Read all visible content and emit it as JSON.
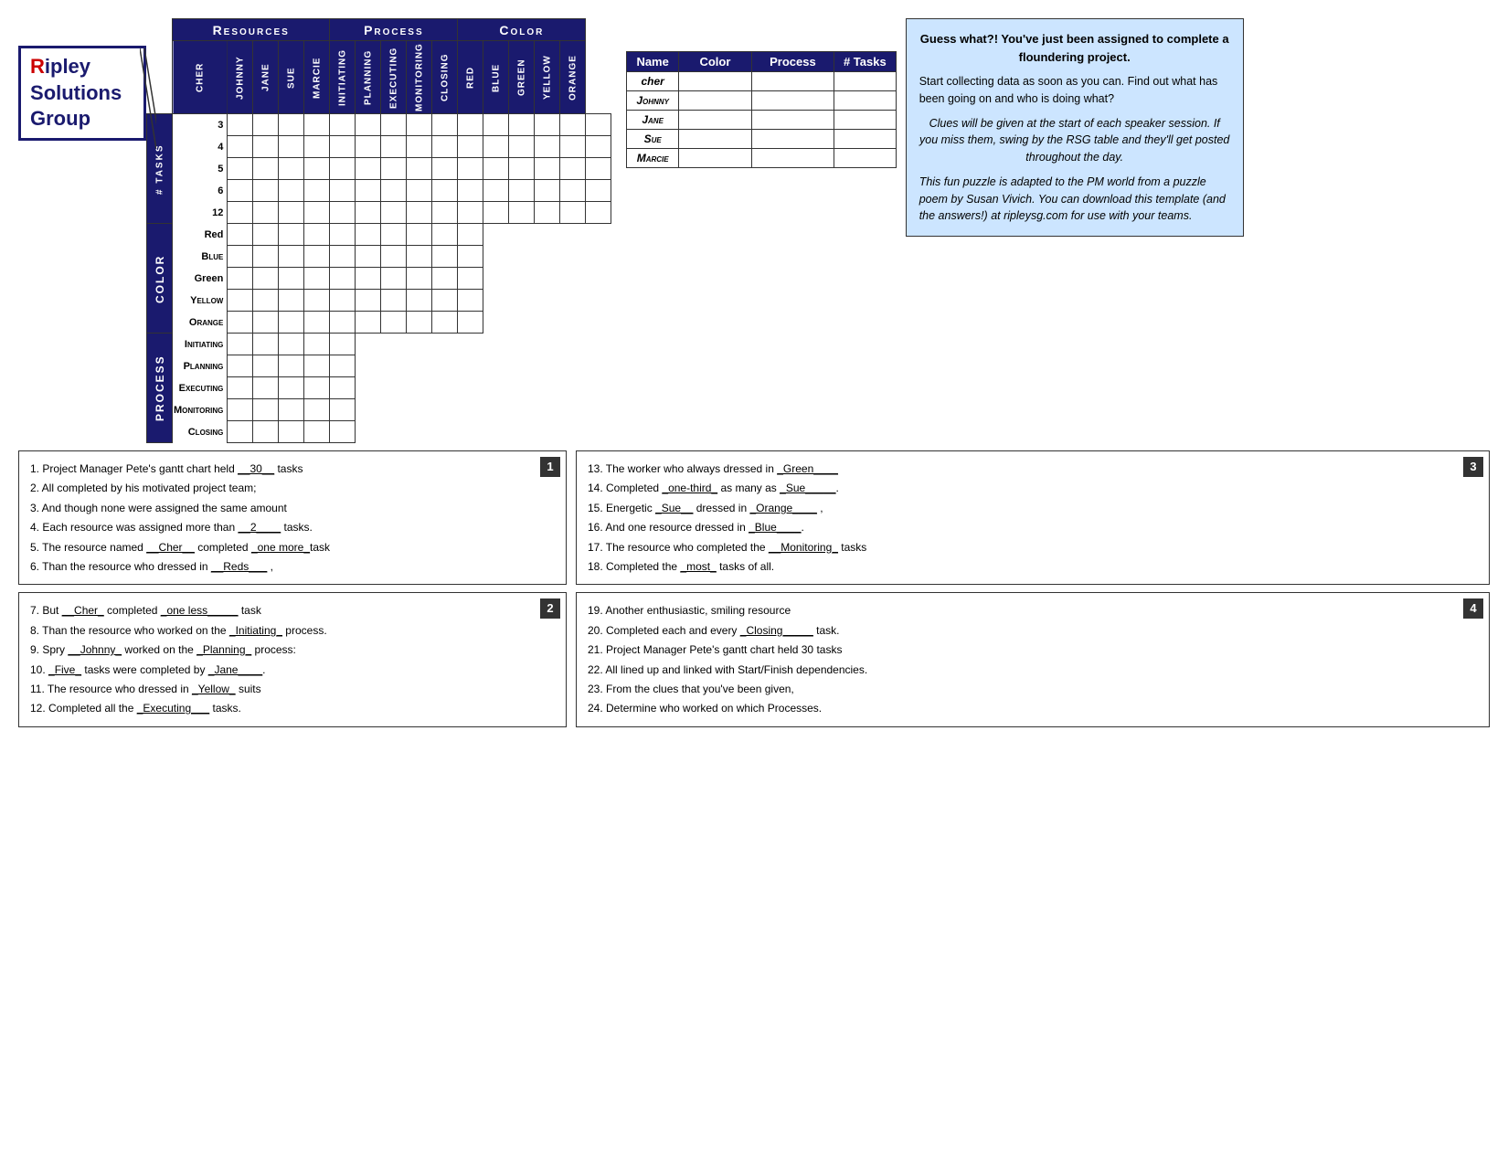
{
  "logo": {
    "r": "R",
    "ipley": "ipley",
    "s": "S",
    "olutions": "olutions",
    "g": "G",
    "roup": "roup"
  },
  "infoBox": {
    "title": "Guess what?! You've just been assigned to complete a floundering project.",
    "body": "Start collecting data as soon as you can.  Find out what has been going on and who is doing what?",
    "clue": "Clues will be given at the start of each speaker session.  If you miss them, swing by the RSG table and they'll get posted throughout the day.",
    "footer": "This fun puzzle is adapted to the PM world from a puzzle poem by Susan Vivich.  You can download this template (and the answers!) at ripleysg.com for use with your teams."
  },
  "grid": {
    "resourcesLabel": "Resources",
    "processLabel": "Process",
    "colorLabel": "Color",
    "resources": [
      "Cher",
      "Johnny",
      "Jane",
      "Sue",
      "Marcie"
    ],
    "process": [
      "Initiating",
      "Planning",
      "Executing",
      "Monitoring",
      "Closing"
    ],
    "colors": [
      "Red",
      "Blue",
      "Green",
      "Yellow",
      "Orange"
    ],
    "taskRows": [
      "3",
      "4",
      "5",
      "6",
      "12"
    ],
    "colorRows": [
      "Red",
      "Blue",
      "Green",
      "Yellow",
      "Orange"
    ],
    "processRows": [
      "Initiating",
      "Planning",
      "Executing",
      "Monitoring",
      "Closing"
    ],
    "sideLabels": {
      "tasks": "# Tasks",
      "color": "Color",
      "process": "Process"
    }
  },
  "summaryTable": {
    "headers": [
      "Name",
      "Color",
      "Process",
      "# Tasks"
    ],
    "rows": [
      {
        "name": "cher"
      },
      {
        "name": "Johnny"
      },
      {
        "name": "Jane"
      },
      {
        "name": "Sue"
      },
      {
        "name": "Marcie"
      }
    ]
  },
  "clues": {
    "box1": {
      "badge": "1",
      "lines": [
        "1.  Project Manager Pete's gantt chart held __30__ tasks",
        "2.  All completed by his motivated project team;",
        "3.  And though none were assigned the same amount",
        "4.  Each resource was assigned more than __2____ tasks.",
        "5.  The resource named __Cher__ completed _one more_task",
        "6.  Than the resource who dressed in __Reds___  ,"
      ]
    },
    "box2": {
      "badge": "2",
      "lines": [
        "7.  But __Cher_ completed _one less_____ task",
        "8.  Than the resource who worked on the _Initiating_ process.",
        "9.  Spry  __Johnny_ worked on the _Planning_ process:",
        "10. _Five_ tasks were completed by _Jane____.",
        "11. The resource who dressed in _Yellow_ suits",
        "12. Completed all the _Executing___ tasks."
      ]
    },
    "box3": {
      "badge": "3",
      "lines": [
        "13. The worker who always dressed in _Green____",
        "14. Completed _one-third_ as many as _Sue_____.",
        "15. Energetic _Sue__ dressed in _Orange____  ,",
        "16. And one resource dressed in _Blue____.",
        "17. The resource who completed the __Monitoring_ tasks",
        "18. Completed the _most_ tasks of all."
      ]
    },
    "box4": {
      "badge": "4",
      "lines": [
        "19. Another enthusiastic, smiling resource",
        "20. Completed each and every _Closing____ task.",
        "21. Project Manager Pete's gantt chart held 30 tasks",
        "22. All lined up and linked with Start/Finish dependencies.",
        "23. From the clues that you've been given,",
        "24. Determine who worked on which Processes."
      ]
    }
  }
}
